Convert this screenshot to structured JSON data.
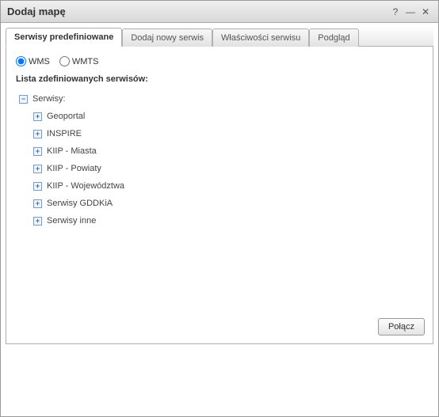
{
  "window": {
    "title": "Dodaj mapę"
  },
  "tabs": {
    "predefined": "Serwisy predefiniowane",
    "addnew": "Dodaj nowy serwis",
    "properties": "Właściwości serwisu",
    "preview": "Podgląd"
  },
  "radio": {
    "wms": "WMS",
    "wmts": "WMTS"
  },
  "list_label": "Lista zdefiniowanych serwisów:",
  "tree": {
    "root": "Serwisy:",
    "items": [
      "Geoportal",
      "INSPIRE",
      "KIIP - Miasta",
      "KIIP - Powiaty",
      "KIIP - Województwa",
      "Serwisy GDDKiA",
      "Serwisy inne"
    ]
  },
  "buttons": {
    "connect": "Połącz"
  },
  "icons": {
    "collapse": "−",
    "expand": "+"
  }
}
